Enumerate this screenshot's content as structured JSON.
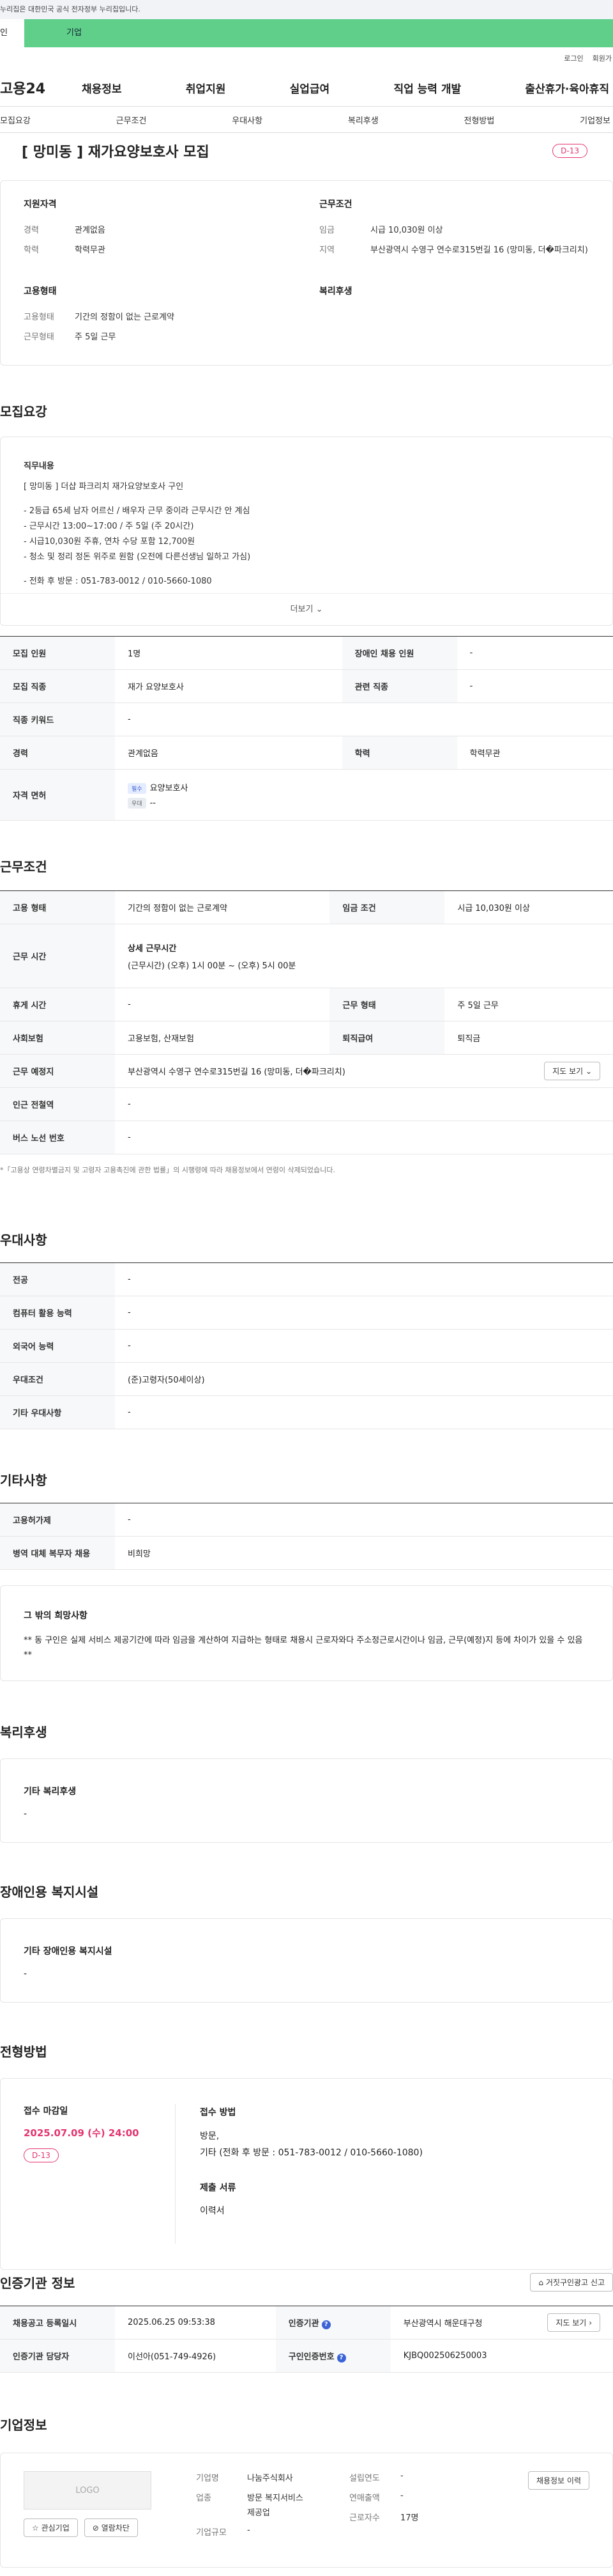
{
  "header": {
    "gov_notice": "누리집은 대한민국 공식 전자정부 누리집입니다.",
    "tab_individual": "인",
    "tab_company": "기업",
    "login": "로그인",
    "signup": "회원가",
    "logo": "고용24",
    "gnb": [
      "채용정보",
      "취업지원",
      "실업급여",
      "직업 능력 개발",
      "출산휴가·육아휴직"
    ],
    "anchor_nav": [
      "모집요강",
      "근무조건",
      "우대사항",
      "복리후생",
      "전형방법",
      "기업정보"
    ]
  },
  "job": {
    "title": "[ 망미동 ] 재가요양보호사 모집",
    "dday": "D-13"
  },
  "summary": {
    "support_title": "지원자격",
    "career_k": "경력",
    "career_v": "관계없음",
    "edu_k": "학력",
    "edu_v": "학력무관",
    "emp_title": "고용형태",
    "emp_k": "고용형태",
    "emp_v": "기간의 정함이 없는 근로계약",
    "workform_k": "근무형태",
    "workform_v": "주 5일 근무",
    "cond_title": "근무조건",
    "wage_k": "임금",
    "wage_v": "시급 10,030원 이상",
    "region_k": "지역",
    "region_v": "부산광역시 수영구 연수로315번길 16 (망미동, 더�파크리치)",
    "welfare_title": "복리후생"
  },
  "recruit": {
    "section_title": "모집요강",
    "duty_title": "직무내용",
    "duty_lines": [
      "[ 망미동 ] 더샵 파크리치 재가요양보호사 구인",
      "",
      "- 2등급 65세 남자 어르신 / 배우자 근무 중이라 근무시간 안 계심",
      "- 근무시간 13:00~17:00 / 주 5일 (주 20시간)",
      "- 시급10,030원 주휴, 연차 수당 포함 12,700원",
      "- 청소 및 정리 정돈 위주로 원함 (오전에 다른선생님 일하고 가심)",
      "",
      "- 전화 후 방문 : 051-783-0012 / 010-5660-1080"
    ],
    "more": "더보기",
    "rows": {
      "headcount_k": "모집 인원",
      "headcount_v": "1명",
      "disabled_k": "장애인 채용 인원",
      "disabled_v": "-",
      "job_k": "모집 직종",
      "job_v": "재가 요양보호사",
      "related_k": "관련 직종",
      "related_v": "-",
      "keyword_k": "직종 키워드",
      "keyword_v": "-",
      "career_k": "경력",
      "career_v": "관계없음",
      "edu_k": "학력",
      "edu_v": "학력무관",
      "license_k": "자격 면허",
      "license_chip": "필수",
      "license_v": "요양보호사",
      "license_chip2": "우대",
      "license_v2": "--"
    }
  },
  "work": {
    "section_title": "근무조건",
    "emp_k": "고용 형태",
    "emp_v": "기간의 정함이 없는 근로계약",
    "wage_k": "임금 조건",
    "wage_v": "시급 10,030원 이상",
    "time_k": "근무 시간",
    "time_title": "상세 근무시간",
    "time_v": "(근무시간) (오후) 1시 00분 ~ (오후) 5시 00분",
    "rest_k": "휴게 시간",
    "rest_v": "-",
    "form_k": "근무 형태",
    "form_v": "주 5일 근무",
    "insurance_k": "사회보험",
    "insurance_v": "고용보험, 산재보험",
    "severance_k": "퇴직급여",
    "severance_v": "퇴직금",
    "place_k": "근무 예정지",
    "place_v": "부산광역시 수영구 연수로315번길 16 (망미동, 더�파크리치)",
    "map_btn": "지도 보기",
    "subway_k": "인근 전철역",
    "subway_v": "-",
    "bus_k": "버스 노선 번호",
    "bus_v": "-",
    "note": "*「고용상 연령차별금지 및 고령자 고용촉진에 관한 법률」의 시행령에 따라 채용정보에서 연령이 삭제되었습니다."
  },
  "pref": {
    "section_title": "우대사항",
    "major_k": "전공",
    "major_v": "-",
    "pc_k": "컴퓨터 활용 능력",
    "pc_v": "-",
    "lang_k": "외국어 능력",
    "lang_v": "-",
    "cond_k": "우대조건",
    "cond_v": "(준)고령자(50세이상)",
    "etc_k": "기타 우대사항",
    "etc_v": "-"
  },
  "other": {
    "section_title": "기타사항",
    "foreigner_k": "고용허가제",
    "foreigner_v": "-",
    "military_k": "병역 대체 복무자 채용",
    "military_v": "비희망",
    "wish_title": "그 밖의 희망사항",
    "wish_v": "** 동 구인은 실제 서비스 제공기간에 따라 임금을 계산하여 지급하는 형태로 채용시 근로자와다 주소정근로시간이나 임금, 근무(예정)지 등에 차이가 있을 수 있음 **"
  },
  "welfare": {
    "section_title": "복리후생",
    "etc_title": "기타 복리후생",
    "etc_v": "-"
  },
  "disabled_fac": {
    "section_title": "장애인용 복지시설",
    "etc_title": "기타 장애인용 복지시설",
    "etc_v": "-"
  },
  "apply": {
    "section_title": "전형방법",
    "deadline_title": "접수 마감일",
    "deadline_v": "2025.07.09 (수) 24:00",
    "dday": "D-13",
    "method_title": "접수 방법",
    "method_line1": "방문,",
    "method_line2": "기타 (전화 후 방문 : 051-783-0012 / 010-5660-1080)",
    "docs_title": "제출 서류",
    "docs_v": "이력서"
  },
  "agency": {
    "section_title": "인증기관 정보",
    "report_btn": "거짓구인광고 신고",
    "reg_k": "채용공고 등록일시",
    "reg_v": "2025.06.25 09:53:38",
    "agency_k": "인증기관",
    "agency_v": "부산광역시 해운대구청",
    "map_btn": "지도 보기",
    "manager_k": "인증기관 담당자",
    "manager_v": "이선아(051-749-4926)",
    "num_k": "구인인증번호",
    "num_v": "KJBQ002506250003"
  },
  "company": {
    "section_title": "기업정보",
    "logo": "LOGO",
    "interest_btn": "관심기업",
    "block_btn": "열람차단",
    "name_k": "기업명",
    "name_v": "나눔주식회사",
    "industry_k": "업종",
    "industry_v1": "방문 복지서비스",
    "industry_v2": "제공업",
    "scale_k": "기업규모",
    "scale_v": "-",
    "year_k": "설립연도",
    "year_v": "-",
    "sales_k": "연매출액",
    "sales_v": "-",
    "staff_k": "근로자수",
    "staff_v": "17명",
    "history_btn": "채용정보 이력"
  }
}
